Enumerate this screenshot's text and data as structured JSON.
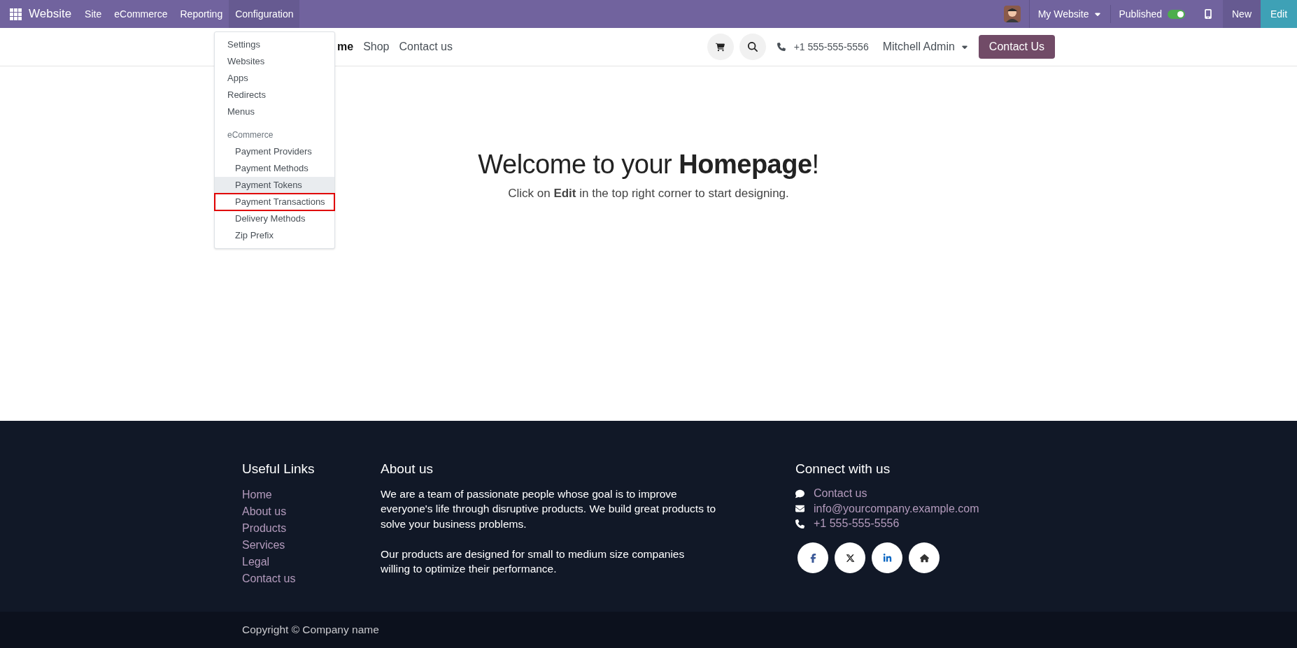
{
  "topbar": {
    "app_name": "Website",
    "menus": [
      {
        "label": "Site",
        "selected": false
      },
      {
        "label": "eCommerce",
        "selected": false
      },
      {
        "label": "Reporting",
        "selected": false
      },
      {
        "label": "Configuration",
        "selected": true
      }
    ],
    "website_selector": "My Website",
    "published": {
      "label": "Published",
      "on": true
    },
    "buttons": [
      {
        "label": "New",
        "kind": "new"
      },
      {
        "label": "Edit",
        "kind": "edit"
      }
    ]
  },
  "config_menu": {
    "items": [
      {
        "kind": "item",
        "label": "Settings",
        "hovered": false,
        "outlined": false
      },
      {
        "kind": "item",
        "label": "Websites",
        "hovered": false,
        "outlined": false
      },
      {
        "kind": "item",
        "label": "Apps",
        "hovered": false,
        "outlined": false
      },
      {
        "kind": "item",
        "label": "Redirects",
        "hovered": false,
        "outlined": false
      },
      {
        "kind": "item",
        "label": "Menus",
        "hovered": false,
        "outlined": false
      },
      {
        "kind": "header",
        "label": "eCommerce",
        "hovered": false,
        "outlined": false
      },
      {
        "kind": "subitem",
        "label": "Payment Providers",
        "hovered": false,
        "outlined": false
      },
      {
        "kind": "subitem",
        "label": "Payment Methods",
        "hovered": false,
        "outlined": false
      },
      {
        "kind": "subitem",
        "label": "Payment Tokens",
        "hovered": true,
        "outlined": false
      },
      {
        "kind": "subitem",
        "label": "Payment Transactions",
        "hovered": false,
        "outlined": true
      },
      {
        "kind": "subitem",
        "label": "Delivery Methods",
        "hovered": false,
        "outlined": false
      },
      {
        "kind": "subitem",
        "label": "Zip Prefix",
        "hovered": false,
        "outlined": false
      }
    ]
  },
  "site_nav": {
    "links": [
      {
        "label": "me",
        "selected": true
      },
      {
        "label": "Shop",
        "selected": false
      },
      {
        "label": "Contact us",
        "selected": false
      }
    ],
    "phone": "+1 555-555-5556",
    "user": "Mitchell Admin",
    "cta": "Contact Us"
  },
  "hero": {
    "title": "Welcome to your **Homepage**!",
    "subtitle": "Click on **Edit** in the top right corner to start designing."
  },
  "footer": {
    "useful_links": {
      "title": "Useful Links",
      "links": [
        "Home",
        "About us",
        "Products",
        "Services",
        "Legal",
        "Contact us"
      ]
    },
    "about": {
      "title": "About us",
      "paragraphs": [
        "We are a team of passionate people whose goal is to improve everyone's life through disruptive products. We build great products to solve your business problems.",
        "Our products are designed for small to medium size companies willing to optimize their performance."
      ]
    },
    "connect": {
      "title": "Connect with us",
      "contacts": [
        {
          "kind": "chat",
          "label": "Contact us"
        },
        {
          "kind": "email",
          "label": "info@yourcompany.example.com"
        },
        {
          "kind": "phone",
          "label": "+1 555-555-5556"
        }
      ],
      "socials": [
        {
          "kind": "facebook"
        },
        {
          "kind": "x"
        },
        {
          "kind": "linkedin"
        },
        {
          "kind": "home"
        }
      ]
    },
    "copyright": "Copyright © Company name"
  }
}
